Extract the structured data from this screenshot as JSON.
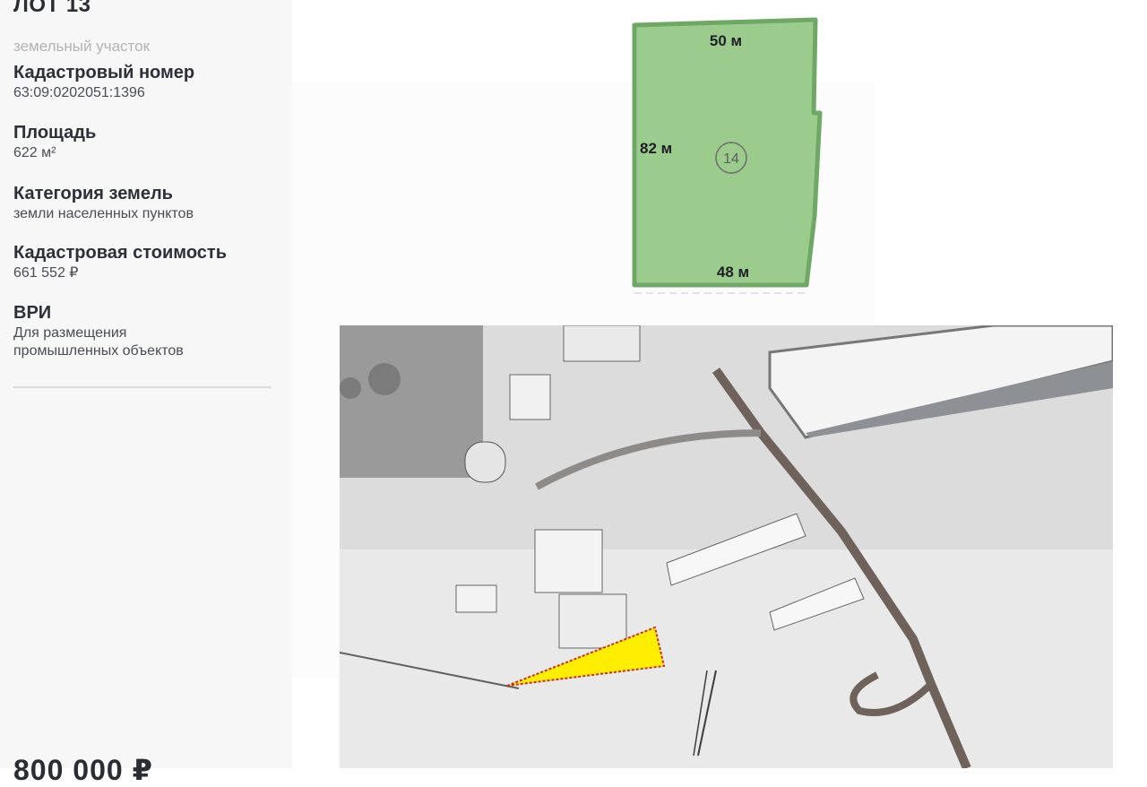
{
  "lot": {
    "title": "ЛОТ 13",
    "subtitle": "земельный участок",
    "properties": [
      {
        "label": "Кадастровый номер",
        "value": "63:09:0202051:1396"
      },
      {
        "label": "Площадь",
        "value": "622 м²"
      },
      {
        "label": "Категория земель",
        "value": "земли населенных пунктов"
      },
      {
        "label": "Кадастровая стоимость",
        "value": "661 552 ₽"
      },
      {
        "label": "ВРИ",
        "value_lines": [
          "Для размещения",
          "промышленных объектов"
        ]
      }
    ],
    "price_partial": "800 000 ₽"
  },
  "scheme": {
    "top_dimension": "50 м",
    "side_dimension": "82 м",
    "bottom_dimension": "48 м",
    "plot_number": "14",
    "fill_color": "#9ccb8e",
    "stroke_color": "#6fa865"
  },
  "photo": {
    "description_icon": "aerial-photo-icon",
    "highlight_color": "#ffee00"
  }
}
